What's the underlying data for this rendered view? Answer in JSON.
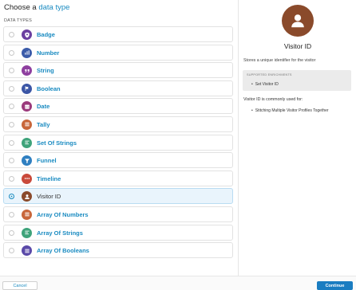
{
  "header": {
    "title_prefix": "Choose a",
    "title_accent": "data type",
    "section_label": "DATA TYPES"
  },
  "types": [
    {
      "label": "Badge",
      "icon": "shield-icon",
      "color": "#6b3fa0"
    },
    {
      "label": "Number",
      "icon": "number-icon",
      "color": "#3b5ba9"
    },
    {
      "label": "String",
      "icon": "quote-icon",
      "color": "#8e3f9f"
    },
    {
      "label": "Boolean",
      "icon": "flag-icon",
      "color": "#3b56a6"
    },
    {
      "label": "Date",
      "icon": "calendar-icon",
      "color": "#9b3a7c"
    },
    {
      "label": "Tally",
      "icon": "list-icon",
      "color": "#c8663a"
    },
    {
      "label": "Set Of Strings",
      "icon": "list-lines-icon",
      "color": "#3ea37a"
    },
    {
      "label": "Funnel",
      "icon": "funnel-icon",
      "color": "#2f7fc1"
    },
    {
      "label": "Timeline",
      "icon": "dots-icon",
      "color": "#c94a3b"
    },
    {
      "label": "Visitor ID",
      "icon": "person-icon",
      "color": "#8a4a2b",
      "selected": true
    },
    {
      "label": "Array Of Numbers",
      "icon": "list-icon",
      "color": "#c8663a"
    },
    {
      "label": "Array Of Strings",
      "icon": "list-lines-icon",
      "color": "#3ea37a"
    },
    {
      "label": "Array Of Booleans",
      "icon": "list-icon",
      "color": "#5a49a8"
    }
  ],
  "detail": {
    "title": "Visitor ID",
    "description": "Stores a unique identifier for the visitor",
    "enrichments_heading": "SUPPORTED ENRICHMENTS",
    "enrichment_item": "Set Visitor ID",
    "use_heading": "Visitor ID is commonly used for:",
    "use_item": "Stitching Multiple Visitor Profiles Together",
    "avatar_color": "#8a4a2b"
  },
  "footer": {
    "cancel_label": "Cancel",
    "continue_label": "Continue"
  }
}
